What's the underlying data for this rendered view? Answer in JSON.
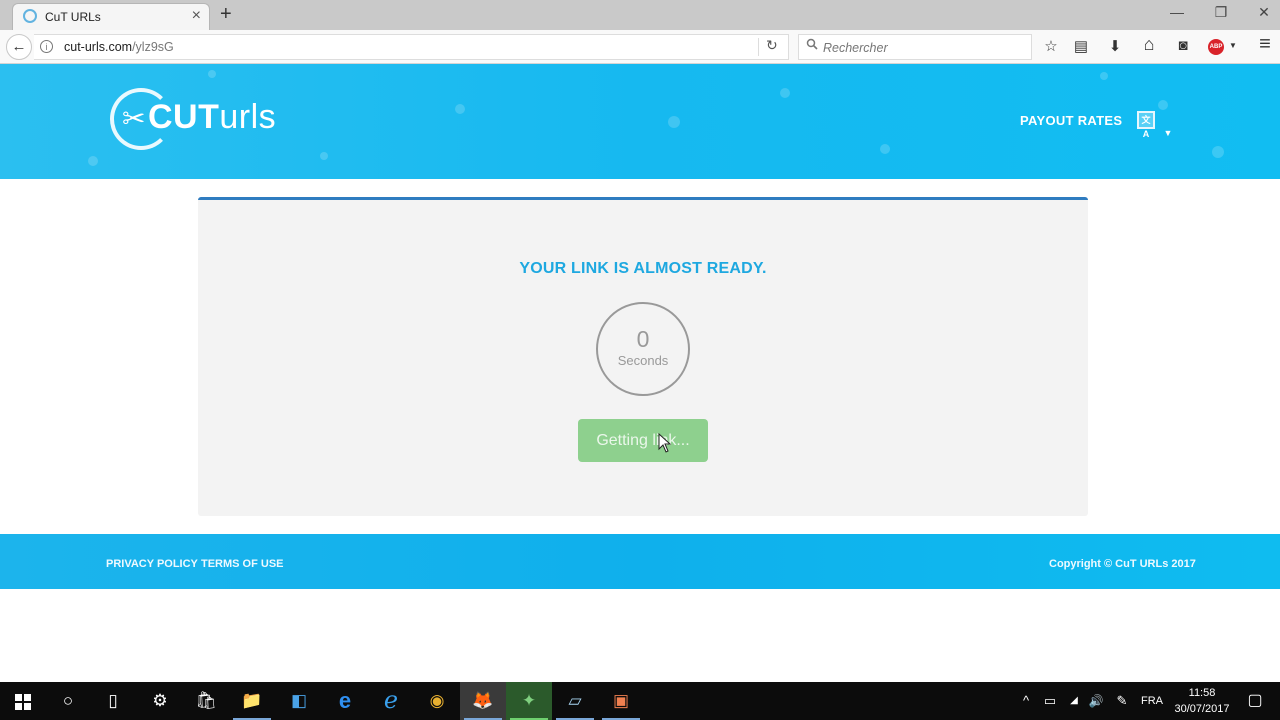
{
  "browser": {
    "tab_title": "CuT URLs",
    "url_domain": "cut-urls.com",
    "url_path": "/ylz9sG",
    "search_placeholder": "Rechercher",
    "icons": {
      "back": "←",
      "info": "i",
      "reload": "↻",
      "search": "🔍",
      "bookmark": "☆",
      "reader": "▤",
      "download": "⬇",
      "home": "⌂",
      "pocket": "◙",
      "abp": "ABP",
      "menu": "≡",
      "close_tab": "×",
      "new_tab": "+",
      "minimize": "—",
      "restore": "❐",
      "close_window": "✕"
    }
  },
  "header": {
    "logo_bold": "CUT",
    "logo_light": "urls",
    "logo_scissors": "✂",
    "nav": {
      "payout_rates": "PAYOUT RATES",
      "language_icon": "文A",
      "caret": "▼"
    }
  },
  "main": {
    "title": "YOUR LINK IS ALMOST READY.",
    "timer": {
      "value": "0",
      "unit": "Seconds"
    },
    "button_label": "Getting link..."
  },
  "footer": {
    "links": [
      "PRIVACY POLICY",
      "TERMS OF USE"
    ],
    "copyright": "Copyright © CuT URLs 2017"
  },
  "taskbar": {
    "start": "⊞",
    "search": "○",
    "task_view": "▯",
    "apps": [
      {
        "name": "settings",
        "glyph": "⚙"
      },
      {
        "name": "store",
        "glyph": "🛍"
      },
      {
        "name": "file-explorer",
        "glyph": "📁"
      },
      {
        "name": "app-blue",
        "glyph": "◧"
      },
      {
        "name": "edge",
        "glyph": "e"
      },
      {
        "name": "internet-explorer",
        "glyph": "ℯ"
      },
      {
        "name": "chrome",
        "glyph": "◉"
      },
      {
        "name": "firefox",
        "glyph": "🦊"
      },
      {
        "name": "download-manager",
        "glyph": "✦"
      },
      {
        "name": "notepad",
        "glyph": "▱"
      },
      {
        "name": "presentation",
        "glyph": "▣"
      }
    ],
    "tray": {
      "chevron": "^",
      "battery": "▭",
      "wifi": "◢",
      "volume": "🔊",
      "pen": "✎",
      "language": "FRA",
      "time": "11:58",
      "date": "30/07/2017",
      "notifications": "▢"
    }
  }
}
